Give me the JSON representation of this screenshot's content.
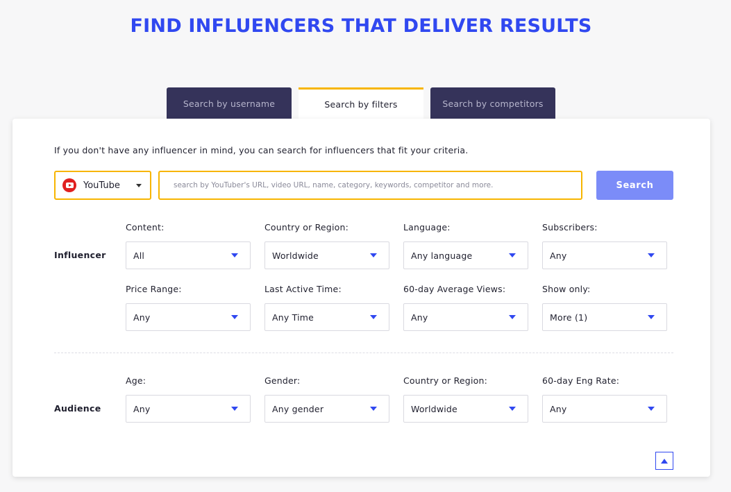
{
  "hero": {
    "title": "FIND INFLUENCERS THAT DELIVER RESULTS"
  },
  "tabs": [
    {
      "label": "Search by username"
    },
    {
      "label": "Search by filters"
    },
    {
      "label": "Search by competitors"
    }
  ],
  "intro": "If you don't have any influencer in mind, you can search for influencers that fit your criteria.",
  "platform": {
    "label": "YouTube",
    "icon": "youtube-icon"
  },
  "search": {
    "placeholder": "search by YouTuber's URL, video URL, name, category, keywords, competitor and more.",
    "button_label": "Search"
  },
  "influencer": {
    "label": "Influencer",
    "filters": [
      {
        "label": "Content:",
        "value": "All"
      },
      {
        "label": "Country or Region:",
        "value": "Worldwide"
      },
      {
        "label": "Language:",
        "value": "Any language"
      },
      {
        "label": "Subscribers:",
        "value": "Any"
      },
      {
        "label": "Price Range:",
        "value": "Any"
      },
      {
        "label": "Last Active Time:",
        "value": "Any Time"
      },
      {
        "label": "60-day Average Views:",
        "value": "Any"
      },
      {
        "label": "Show only:",
        "value": "More (1)"
      }
    ]
  },
  "audience": {
    "label": "Audience",
    "filters": [
      {
        "label": "Age:",
        "value": "Any"
      },
      {
        "label": "Gender:",
        "value": "Any gender"
      },
      {
        "label": "Country or Region:",
        "value": "Worldwide"
      },
      {
        "label": "60-day Eng Rate:",
        "value": "Any"
      }
    ]
  },
  "colors": {
    "accent": "#3048f0",
    "tab_dark": "#35335a",
    "highlight": "#f7b500",
    "search_button": "#7b8cf8"
  }
}
